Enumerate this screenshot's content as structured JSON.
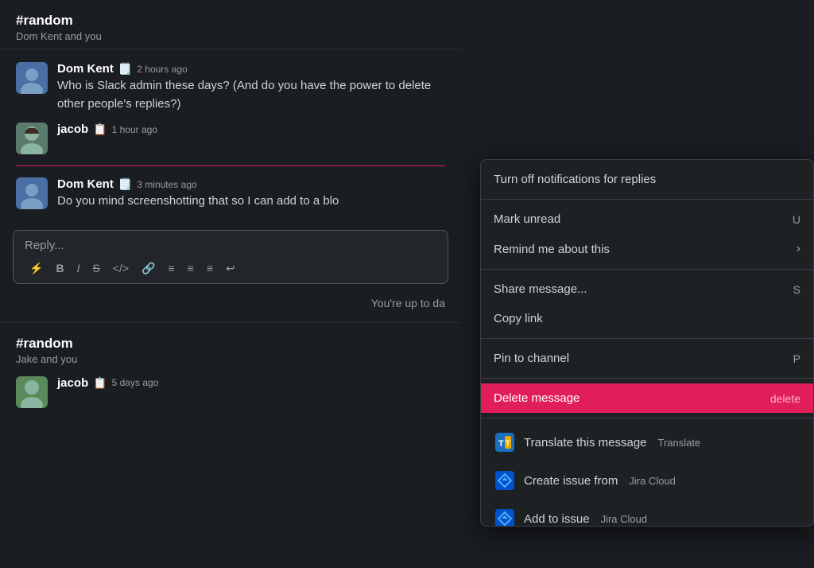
{
  "channels": [
    {
      "name": "#random",
      "subtitle": "Dom Kent and you"
    },
    {
      "name": "#random",
      "subtitle": "Jake and you"
    }
  ],
  "messages": [
    {
      "id": "msg1",
      "username": "Dom Kent",
      "badge": "🗒️",
      "timestamp": "2 hours ago",
      "text": "Who is Slack admin these days? (And do you have the power to delete other people's replies?)",
      "avatar_color": "dom1"
    },
    {
      "id": "msg2",
      "username": "jacob",
      "badge": "📋",
      "timestamp": "1 hour ago",
      "text": "",
      "avatar_color": "jacob"
    },
    {
      "id": "msg3",
      "username": "Dom Kent",
      "badge": "🗒️",
      "timestamp": "3 minutes ago",
      "text": "Do you mind screenshotting that so I can add to a blo",
      "avatar_color": "dom2",
      "truncated": true
    }
  ],
  "reply_input": {
    "placeholder": "Reply..."
  },
  "up_to_date_text": "You're up to da",
  "second_message": {
    "username": "jacob",
    "badge": "📋",
    "timestamp": "5 days ago",
    "avatar_color": "jacob2"
  },
  "context_menu": {
    "items": [
      {
        "section": 1,
        "label": "Turn off notifications for replies",
        "shortcut": "",
        "arrow": false,
        "has_icon": false
      },
      {
        "section": 2,
        "label": "Mark unread",
        "shortcut": "U",
        "arrow": false,
        "has_icon": false
      },
      {
        "section": 2,
        "label": "Remind me about this",
        "shortcut": "",
        "arrow": true,
        "has_icon": false
      },
      {
        "section": 3,
        "label": "Share message...",
        "shortcut": "S",
        "arrow": false,
        "has_icon": false
      },
      {
        "section": 3,
        "label": "Copy link",
        "shortcut": "",
        "arrow": false,
        "has_icon": false
      },
      {
        "section": 4,
        "label": "Pin to channel",
        "shortcut": "P",
        "arrow": false,
        "has_icon": false
      },
      {
        "section": 5,
        "label": "Delete message",
        "shortcut": "delete",
        "arrow": false,
        "has_icon": false,
        "type": "delete"
      },
      {
        "section": 6,
        "label": "Translate this message",
        "sublabel": "Translate",
        "shortcut": "",
        "arrow": false,
        "has_icon": true,
        "icon": "🔡"
      },
      {
        "section": 6,
        "label": "Create issue from",
        "sublabel": "Jira Cloud",
        "shortcut": "",
        "arrow": false,
        "has_icon": true,
        "icon": "📋"
      },
      {
        "section": 6,
        "label": "Add to issue",
        "sublabel": "Jira Cloud",
        "shortcut": "",
        "arrow": false,
        "has_icon": true,
        "icon": "📋"
      }
    ]
  },
  "toolbar": {
    "buttons": [
      "⚡",
      "B",
      "I",
      "S",
      "<>",
      "🔗",
      "≡",
      "≡",
      "≡",
      "↩"
    ]
  },
  "expand_arrow": "›"
}
